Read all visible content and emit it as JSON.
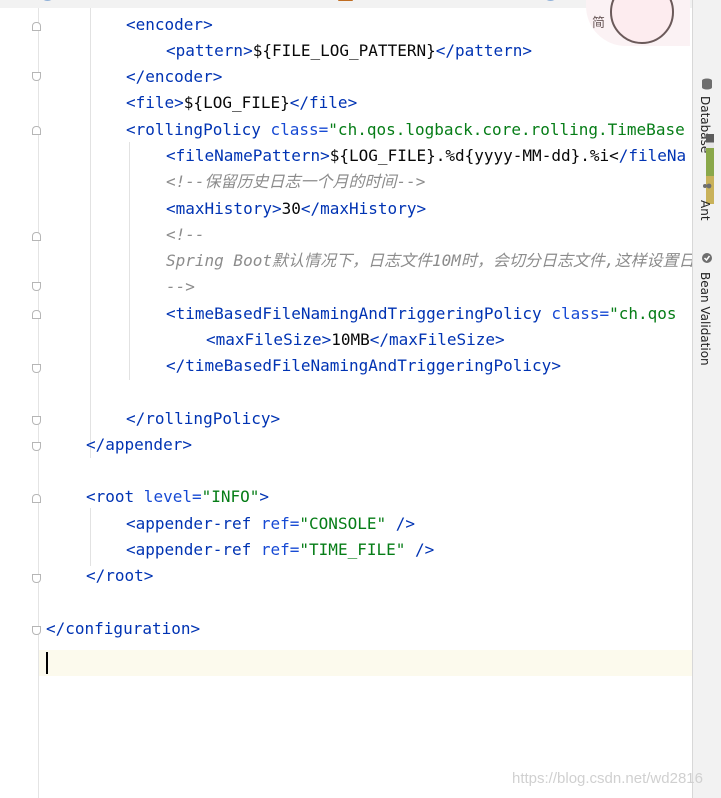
{
  "tabs": [
    {
      "label": "",
      "icon": "file-icon"
    },
    {
      "label": "",
      "icon": "xml-file-icon",
      "active": true
    },
    {
      "label": "",
      "icon": "file-icon"
    }
  ],
  "tool_windows": [
    {
      "label": "Database",
      "icon": "database-icon"
    },
    {
      "label": "Ant",
      "icon": "ant-icon"
    },
    {
      "label": "Bean Validation",
      "icon": "bean-validation-icon"
    }
  ],
  "avatar_text": "简",
  "code": {
    "l1_open": "<encoder>",
    "l2_open": "<pattern>",
    "l2_text": "${FILE_LOG_PATTERN}",
    "l2_close": "</pattern>",
    "l3_close": "</encoder>",
    "l4_open": "<file>",
    "l4_text": "${LOG_FILE}",
    "l4_close": "</file>",
    "l5_tag": "<rollingPolicy",
    "l5_attr": " class=",
    "l5_val": "\"ch.qos.logback.core.rolling.TimeBase",
    "l6_open": "<fileNamePattern>",
    "l6_text": "${LOG_FILE}.%d{yyyy-MM-dd}.%i<",
    "l6_close": "/fileNa",
    "l7_comment": "<!--保留历史日志一个月的时间-->",
    "l8_open": "<maxHistory>",
    "l8_text": "30",
    "l8_close": "</maxHistory>",
    "l9_comment": "<!--",
    "l10_comment": "Spring Boot默认情况下，日志文件10M时，会切分日志文件,这样设置日",
    "l11_comment": "-->",
    "l12_tag": "<timeBasedFileNamingAndTriggeringPolicy",
    "l12_attr": " class=",
    "l12_val": "\"ch.qos",
    "l13_open": "<maxFileSize>",
    "l13_text": "10MB",
    "l13_close": "</maxFileSize>",
    "l14_close": "</timeBasedFileNamingAndTriggeringPolicy>",
    "l16_close": "</rollingPolicy>",
    "l17_close": "</appender>",
    "l19_tag": "<root",
    "l19_attr": " level=",
    "l19_val": "\"INFO\"",
    "l19_end": ">",
    "l20_tag": "<appender-ref",
    "l20_attr": " ref=",
    "l20_val": "\"CONSOLE\"",
    "l20_end": " />",
    "l21_tag": "<appender-ref",
    "l21_attr": " ref=",
    "l21_val": "\"TIME_FILE\"",
    "l21_end": " />",
    "l22_close": "</root>",
    "l24_close": "</configuration>"
  },
  "watermark": "https://blog.csdn.net/wd2816"
}
